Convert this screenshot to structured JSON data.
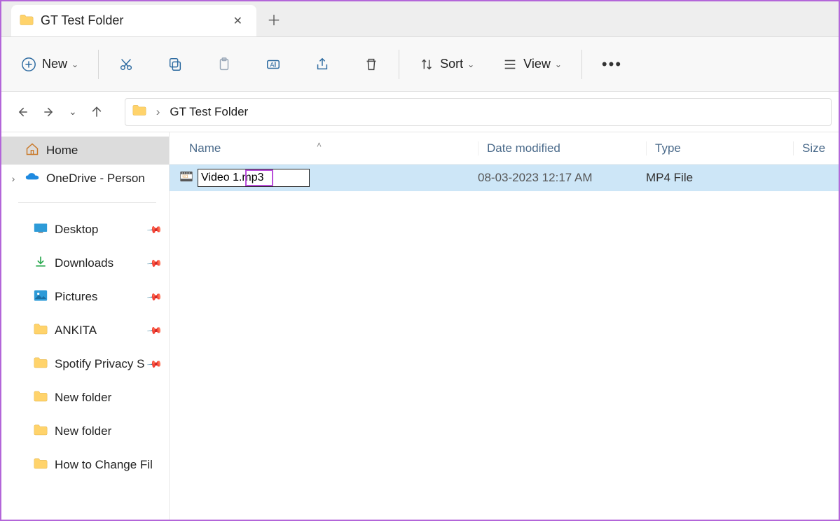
{
  "titlebar": {
    "tab_title": "GT Test Folder"
  },
  "toolbar": {
    "new_label": "New",
    "sort_label": "Sort",
    "view_label": "View"
  },
  "address": {
    "folder": "GT Test Folder"
  },
  "sidebar": {
    "home": "Home",
    "onedrive": "OneDrive - Person",
    "items": [
      {
        "label": "Desktop",
        "icon": "desktop",
        "pinned": true
      },
      {
        "label": "Downloads",
        "icon": "download",
        "pinned": true
      },
      {
        "label": "Pictures",
        "icon": "pictures",
        "pinned": true
      },
      {
        "label": "ANKITA",
        "icon": "folder",
        "pinned": true
      },
      {
        "label": "Spotify Privacy S",
        "icon": "folder",
        "pinned": true
      },
      {
        "label": "New folder",
        "icon": "folder",
        "pinned": false
      },
      {
        "label": "New folder",
        "icon": "folder",
        "pinned": false
      },
      {
        "label": "How to Change Fil",
        "icon": "folder",
        "pinned": false
      }
    ]
  },
  "columns": {
    "name": "Name",
    "date": "Date modified",
    "type": "Type",
    "size": "Size"
  },
  "files": [
    {
      "name_edit": "Video 1.mp3",
      "date": "08-03-2023 12:17 AM",
      "type": "MP4 File",
      "size": ""
    }
  ]
}
